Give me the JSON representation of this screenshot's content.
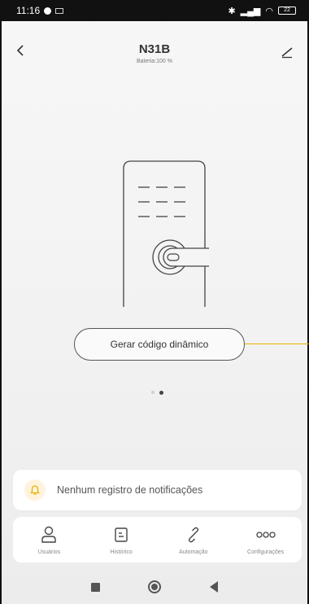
{
  "status_bar": {
    "time": "11:16",
    "battery": "22"
  },
  "header": {
    "title": "N31B",
    "subtitle": "Bateria:100 %"
  },
  "main": {
    "dynamic_code_button": "Gerar código dinâmico",
    "pager": {
      "count": 2,
      "active_index": 1
    }
  },
  "notification": {
    "text": "Nenhum registro de notificações",
    "icon": "bell-icon"
  },
  "nav": {
    "items": [
      {
        "label": "Usuários",
        "icon": "user-icon"
      },
      {
        "label": "Histórico",
        "icon": "history-icon"
      },
      {
        "label": "Automação",
        "icon": "link-icon"
      },
      {
        "label": "Configurações",
        "icon": "more-icon"
      }
    ]
  },
  "colors": {
    "accent": "#e8b100",
    "text": "#333333",
    "card": "#ffffff"
  }
}
